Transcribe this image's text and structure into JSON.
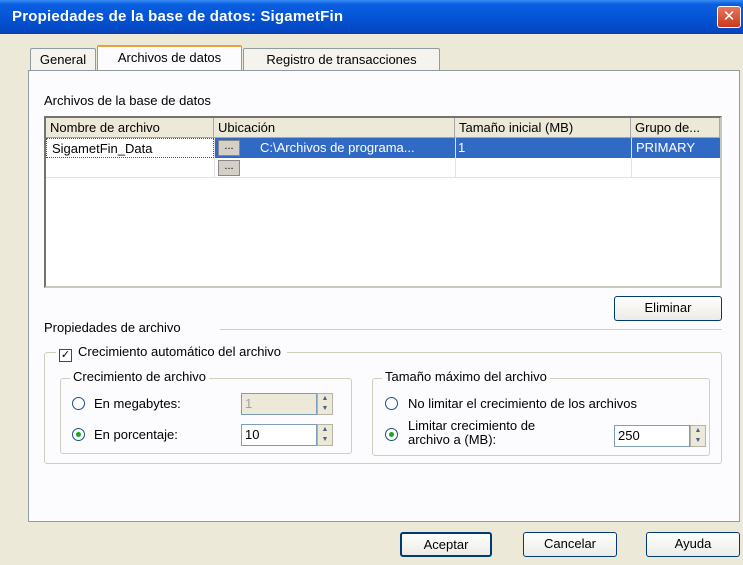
{
  "window": {
    "title": "Propiedades de la base de datos: SigametFin",
    "close_glyph": "✕"
  },
  "tabs": [
    {
      "label": "General"
    },
    {
      "label": "Archivos de datos"
    },
    {
      "label": "Registro de transacciones"
    }
  ],
  "files_section": {
    "label": "Archivos de la base de datos",
    "columns": [
      "Nombre de archivo",
      "Ubicación",
      "Tamaño inicial (MB)",
      "Grupo de..."
    ],
    "rows": [
      {
        "name": "SigametFin_Data",
        "location": "C:\\Archivos de programa...",
        "size": "1",
        "group": "PRIMARY"
      }
    ],
    "ellipsis": "..."
  },
  "delete_button": "Eliminar",
  "file_properties": {
    "label": "Propiedades de archivo",
    "autogrow_label": "Crecimiento automático del archivo",
    "autogrow_checked": true,
    "growth": {
      "label": "Crecimiento de archivo",
      "megabytes_label": "En megabytes:",
      "megabytes_value": "1",
      "percent_label": "En porcentaje:",
      "percent_value": "10",
      "selected": "percent"
    },
    "max_size": {
      "label": "Tamaño máximo del archivo",
      "unlimited_label": "No limitar el crecimiento de los archivos",
      "limit_label_line1": "Limitar crecimiento de",
      "limit_label_line2": "archivo a (MB):",
      "limit_value": "250",
      "selected": "limit"
    }
  },
  "buttons": {
    "ok": "Aceptar",
    "cancel": "Cancelar",
    "help": "Ayuda"
  },
  "colors": {
    "title_bar": "#0554d6",
    "selection": "#316ac5",
    "dialog_bg": "#ece9d8"
  }
}
